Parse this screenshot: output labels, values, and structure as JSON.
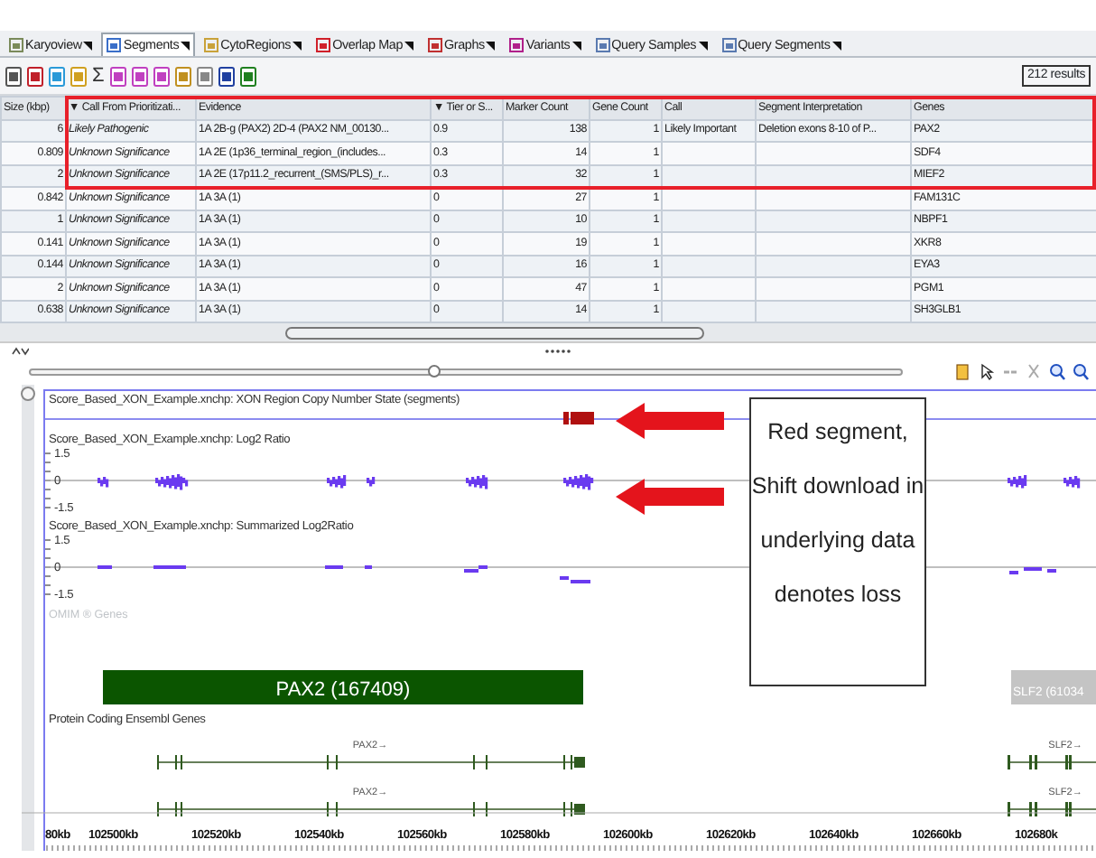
{
  "tabs": [
    {
      "label": "Karyoview",
      "selected": false
    },
    {
      "label": "Segments",
      "selected": true
    },
    {
      "label": "CytoRegions",
      "selected": false
    },
    {
      "label": "Overlap Map",
      "selected": false
    },
    {
      "label": "Graphs",
      "selected": false
    },
    {
      "label": "Variants",
      "selected": false
    },
    {
      "label": "Query Samples",
      "selected": false
    },
    {
      "label": "Query Segments",
      "selected": false
    }
  ],
  "toolbar": {
    "sigma": "Σ",
    "results": "212 results"
  },
  "zoom_slider": {
    "level": 0.46
  },
  "table": {
    "columns": [
      "Size (kbp)",
      "▼ Call From Prioritizati...",
      "Evidence",
      "▼ Tier or S...",
      "Marker Count",
      "Gene Count",
      "Call",
      "Segment Interpretation",
      "Genes"
    ],
    "rows": [
      {
        "highlighted": true,
        "cells": [
          "6",
          "Likely Pathogenic",
          "1A 2B-g (PAX2) 2D-4 (PAX2 NM_00130...",
          "0.9",
          "138",
          "1",
          "Likely Important",
          "Deletion exons 8-10 of P...",
          "PAX2"
        ]
      },
      {
        "highlighted": true,
        "cells": [
          "0.809",
          "Unknown Significance",
          "1A 2E (1p36_terminal_region_(includes...",
          "0.3",
          "14",
          "1",
          "",
          "",
          "SDF4"
        ]
      },
      {
        "highlighted": true,
        "cells": [
          "2",
          "Unknown Significance",
          "1A 2E (17p11.2_recurrent_(SMS/PLS)_r...",
          "0.3",
          "32",
          "1",
          "",
          "",
          "MIEF2"
        ]
      },
      {
        "highlighted": false,
        "cells": [
          "0.842",
          "Unknown Significance",
          "1A 3A (1)",
          "0",
          "27",
          "1",
          "",
          "",
          "FAM131C"
        ]
      },
      {
        "highlighted": false,
        "cells": [
          "1",
          "Unknown Significance",
          "1A 3A (1)",
          "0",
          "10",
          "1",
          "",
          "",
          "NBPF1"
        ]
      },
      {
        "highlighted": false,
        "cells": [
          "0.141",
          "Unknown Significance",
          "1A 3A (1)",
          "0",
          "19",
          "1",
          "",
          "",
          "XKR8"
        ]
      },
      {
        "highlighted": false,
        "cells": [
          "0.144",
          "Unknown Significance",
          "1A 3A (1)",
          "0",
          "16",
          "1",
          "",
          "",
          "EYA3"
        ]
      },
      {
        "highlighted": false,
        "cells": [
          "2",
          "Unknown Significance",
          "1A 3A (1)",
          "0",
          "47",
          "1",
          "",
          "",
          "PGM1"
        ]
      },
      {
        "highlighted": false,
        "cells": [
          "0.638",
          "Unknown Significance",
          "1A 3A (1)",
          "0",
          "14",
          "1",
          "",
          "",
          "SH3GLB1"
        ]
      }
    ]
  },
  "viewer": {
    "segments_title": "Score_Based_XON_Example.xnchp: XON Region Copy Number State (segments)",
    "log2_title": "Score_Based_XON_Example.xnchp: Log2 Ratio",
    "log2_labels": [
      "1.5",
      "0",
      "-1.5"
    ],
    "summarized_title": "Score_Based_XON_Example.xnchp: Summarized Log2Ratio",
    "summarized_labels": [
      "1.5",
      "0",
      "-1.5"
    ],
    "omim_title": "OMIM ® Genes",
    "omim_genes": [
      {
        "label": "PAX2 (167409)",
        "color": "#0b5500"
      },
      {
        "label": "SLF2 (61034",
        "color": "#c4c4c4"
      }
    ],
    "ensembl_title": "Protein Coding Ensembl Genes",
    "transcripts": [
      [
        "PAX2→",
        "SLF2→"
      ],
      [
        "PAX2→",
        "SLF2→"
      ]
    ],
    "axis_ticks": [
      "80kb",
      "102500kb",
      "102520kb",
      "102540kb",
      "102560kb",
      "102580kb",
      "102600kb",
      "102620kb",
      "102640kb",
      "102660kb",
      "102680k"
    ],
    "annotation": "Red segment, Shift download in underlying data denotes loss"
  }
}
